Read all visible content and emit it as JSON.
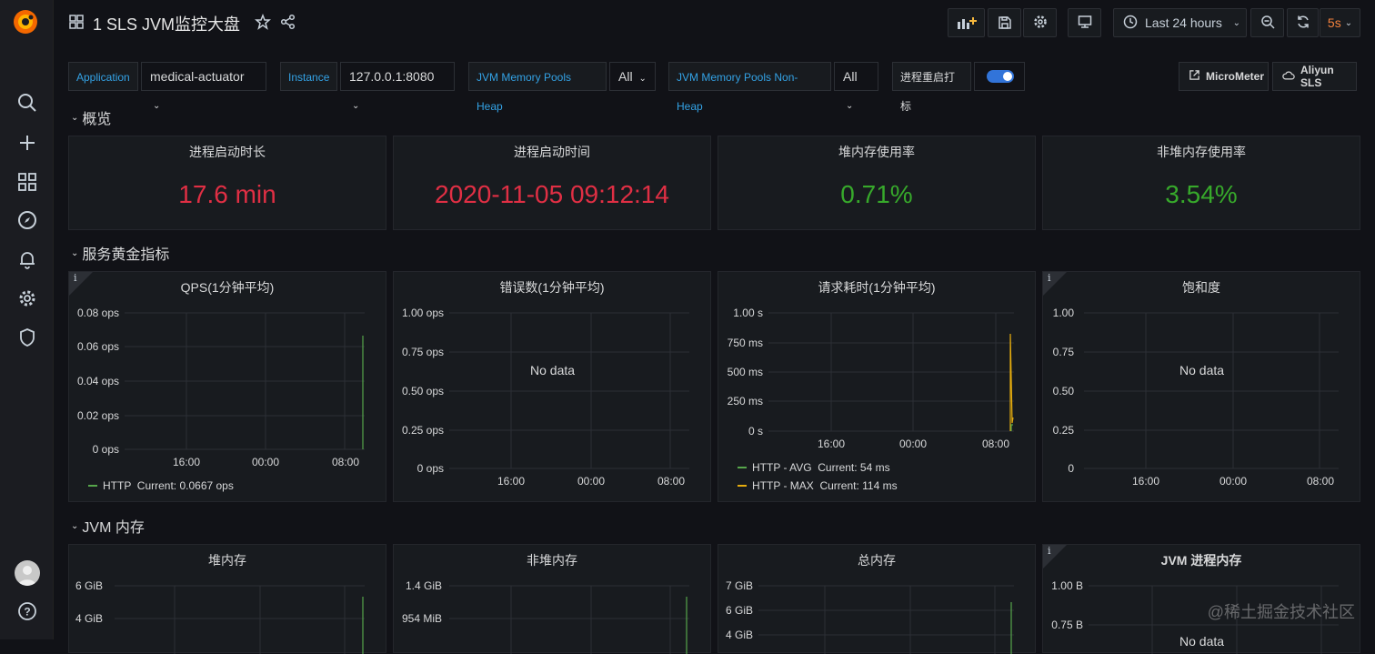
{
  "header": {
    "title": "1 SLS JVM监控大盘",
    "time_range": "Last 24 hours",
    "refresh": "5s"
  },
  "variables": [
    {
      "label": "Application",
      "value": "medical-actuator"
    },
    {
      "label": "Instance",
      "value": "127.0.0.1:8080"
    },
    {
      "label": "JVM Memory Pools Heap",
      "value": "All"
    },
    {
      "label": "JVM Memory Pools Non-Heap",
      "value": "All"
    },
    {
      "label": "进程重启打标",
      "toggle": true
    }
  ],
  "links": [
    "MicroMeter",
    "Aliyun SLS"
  ],
  "rows": {
    "overview": "概览",
    "golden": "服务黄金指标",
    "jvm_memory": "JVM 内存"
  },
  "stats": [
    {
      "title": "进程启动时长",
      "value": "17.6 min",
      "color": "#e02f44"
    },
    {
      "title": "进程启动时间",
      "value": "2020-11-05 09:12:14",
      "color": "#e02f44"
    },
    {
      "title": "堆内存使用率",
      "value": "0.71%",
      "color": "#37a92b"
    },
    {
      "title": "非堆内存使用率",
      "value": "3.54%",
      "color": "#37a92b"
    }
  ],
  "graphs": {
    "qps": {
      "title": "QPS(1分钟平均)",
      "yticks": [
        "0.08 ops",
        "0.06 ops",
        "0.04 ops",
        "0.02 ops",
        "0 ops"
      ],
      "xticks": [
        "16:00",
        "00:00",
        "08:00"
      ],
      "legend": [
        {
          "text": "HTTP  Current: 0.0667 ops",
          "color": "#56a64b"
        }
      ]
    },
    "errors": {
      "title": "错误数(1分钟平均)",
      "yticks": [
        "1.00 ops",
        "0.75 ops",
        "0.50 ops",
        "0.25 ops",
        "0 ops"
      ],
      "xticks": [
        "16:00",
        "00:00",
        "08:00"
      ],
      "no_data": "No data"
    },
    "latency": {
      "title": "请求耗时(1分钟平均)",
      "yticks": [
        "1.00 s",
        "750 ms",
        "500 ms",
        "250 ms",
        "0 s"
      ],
      "xticks": [
        "16:00",
        "00:00",
        "08:00"
      ],
      "legend": [
        {
          "text": "HTTP - AVG  Current: 54 ms",
          "color": "#56a64b"
        },
        {
          "text": "HTTP - MAX  Current: 114 ms",
          "color": "#e5ac0e"
        }
      ]
    },
    "saturation": {
      "title": "饱和度",
      "yticks": [
        "1.00",
        "0.75",
        "0.50",
        "0.25",
        "0"
      ],
      "xticks": [
        "16:00",
        "00:00",
        "08:00"
      ],
      "no_data": "No data"
    },
    "heap": {
      "title": "堆内存",
      "yticks": [
        "6 GiB",
        "4 GiB"
      ]
    },
    "nonheap": {
      "title": "非堆内存",
      "yticks": [
        "1.4 GiB",
        "954 MiB"
      ]
    },
    "total": {
      "title": "总内存",
      "yticks": [
        "7 GiB",
        "6 GiB",
        "4 GiB"
      ]
    },
    "process": {
      "title": "JVM 进程内存",
      "yticks": [
        "1.00 B",
        "0.75 B"
      ],
      "no_data": "No data"
    }
  },
  "watermark": "@稀土掘金技术社区"
}
